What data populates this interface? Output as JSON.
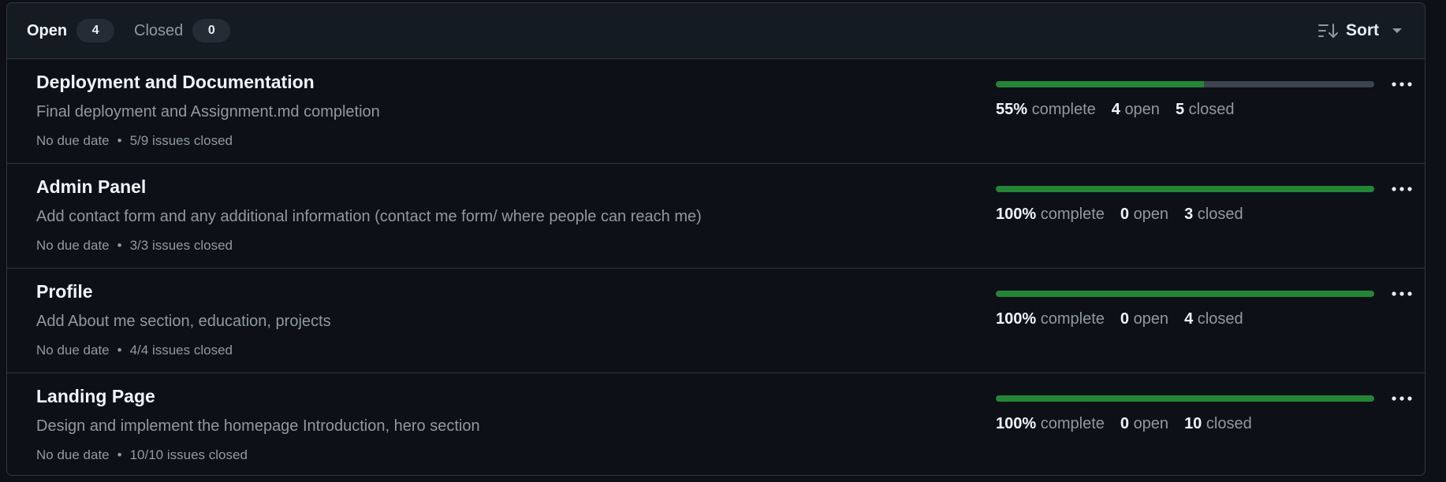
{
  "tabs": {
    "open": {
      "label": "Open",
      "count": "4"
    },
    "closed": {
      "label": "Closed",
      "count": "0"
    }
  },
  "sort": {
    "label": "Sort",
    "icon": "sort-icon"
  },
  "colors": {
    "background": "#0d1117",
    "header": "#151b23",
    "border": "#30363d",
    "progress_fill": "#238636",
    "progress_track": "#3d444d",
    "muted_text": "#9198a1"
  },
  "milestones": [
    {
      "title": "Deployment and Documentation",
      "description": "Final deployment and Assignment.md completion",
      "due": "No due date",
      "issues": "5/9 issues closed",
      "progress": 55,
      "percent": "55%",
      "complete_label": "complete",
      "open_count": "4",
      "open_label": "open",
      "closed_count": "5",
      "closed_label": "closed"
    },
    {
      "title": "Admin Panel",
      "description": "Add contact form and any additional information (contact me form/ where people can reach me)",
      "due": "No due date",
      "issues": "3/3 issues closed",
      "progress": 100,
      "percent": "100%",
      "complete_label": "complete",
      "open_count": "0",
      "open_label": "open",
      "closed_count": "3",
      "closed_label": "closed"
    },
    {
      "title": "Profile",
      "description": "Add About me section, education, projects",
      "due": "No due date",
      "issues": "4/4 issues closed",
      "progress": 100,
      "percent": "100%",
      "complete_label": "complete",
      "open_count": "0",
      "open_label": "open",
      "closed_count": "4",
      "closed_label": "closed"
    },
    {
      "title": "Landing Page",
      "description": "Design and implement the homepage Introduction, hero section",
      "due": "No due date",
      "issues": "10/10 issues closed",
      "progress": 100,
      "percent": "100%",
      "complete_label": "complete",
      "open_count": "0",
      "open_label": "open",
      "closed_count": "10",
      "closed_label": "closed"
    }
  ],
  "meta_separator": "•"
}
